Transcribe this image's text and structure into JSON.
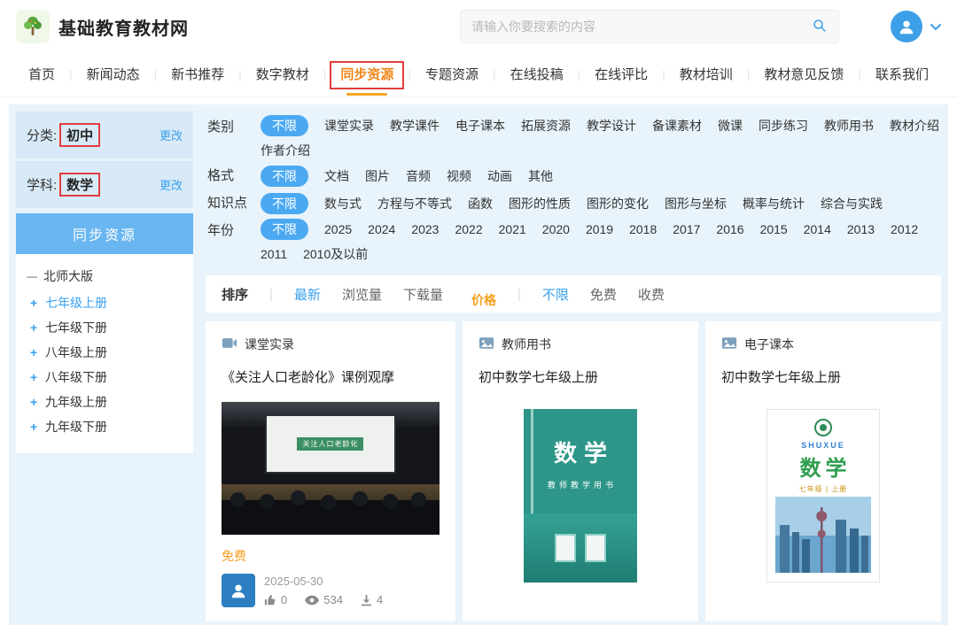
{
  "header": {
    "site_title": "基础教育教材网",
    "search": {
      "placeholder": "请输入你要搜索的内容"
    }
  },
  "nav": {
    "items": [
      {
        "label": "首页"
      },
      {
        "label": "新闻动态"
      },
      {
        "label": "新书推荐"
      },
      {
        "label": "数字教材"
      },
      {
        "label": "同步资源",
        "active": true
      },
      {
        "label": "专题资源"
      },
      {
        "label": "在线投稿"
      },
      {
        "label": "在线评比"
      },
      {
        "label": "教材培训"
      },
      {
        "label": "教材意见反馈"
      },
      {
        "label": "联系我们"
      }
    ]
  },
  "sidebar": {
    "category": {
      "label": "分类:",
      "value": "初中",
      "action": "更改"
    },
    "subject": {
      "label": "学科:",
      "value": "数学",
      "action": "更改"
    },
    "panel_title": "同步资源",
    "edition": "北师大版",
    "grades": [
      {
        "label": "七年级上册",
        "active": true
      },
      {
        "label": "七年级下册"
      },
      {
        "label": "八年级上册"
      },
      {
        "label": "八年级下册"
      },
      {
        "label": "九年级上册"
      },
      {
        "label": "九年级下册"
      }
    ]
  },
  "filters": [
    {
      "label": "类别",
      "selected": "不限",
      "options": [
        "不限",
        "课堂实录",
        "教学课件",
        "电子课本",
        "拓展资源",
        "教学设计",
        "备课素材",
        "微课",
        "同步练习",
        "教师用书",
        "教材介绍",
        "作者介绍"
      ]
    },
    {
      "label": "格式",
      "selected": "不限",
      "options": [
        "不限",
        "文档",
        "图片",
        "音频",
        "视频",
        "动画",
        "其他"
      ]
    },
    {
      "label": "知识点",
      "selected": "不限",
      "options": [
        "不限",
        "数与式",
        "方程与不等式",
        "函数",
        "图形的性质",
        "图形的变化",
        "图形与坐标",
        "概率与统计",
        "综合与实践"
      ]
    },
    {
      "label": "年份",
      "selected": "不限",
      "options": [
        "不限",
        "2025",
        "2024",
        "2023",
        "2022",
        "2021",
        "2020",
        "2019",
        "2018",
        "2017",
        "2016",
        "2015",
        "2014",
        "2013",
        "2012",
        "2011",
        "2010及以前"
      ]
    }
  ],
  "sort_bar": {
    "sort_label": "排序",
    "sort_options": [
      {
        "label": "最新",
        "active": true
      },
      {
        "label": "浏览量"
      },
      {
        "label": "下载量"
      }
    ],
    "price_label": "价格",
    "price_options": [
      {
        "label": "不限",
        "active": true
      },
      {
        "label": "免费"
      },
      {
        "label": "收费"
      }
    ]
  },
  "cards": [
    {
      "type": "课堂实录",
      "title": "《关注人口老龄化》课例观摩",
      "image_caption": "关注人口老龄化",
      "price": "免费",
      "date": "2025-05-30",
      "likes": "0",
      "views": "534",
      "downloads": "4"
    },
    {
      "type": "教师用书",
      "title": "初中数学七年级上册",
      "cover": {
        "title": "数学",
        "subtitle": "教师教学用书"
      }
    },
    {
      "type": "电子课本",
      "title": "初中数学七年级上册",
      "cover": {
        "pinyin": "SHUXUE",
        "title": "数学",
        "edition": "七年级 | 上册"
      }
    }
  ],
  "colors": {
    "accent_blue": "#3aa0ee",
    "pill_blue": "#4ba9f2",
    "orange": "#f5a01e",
    "active_tab_orange": "#f0861a",
    "annotation_red": "#e23c3c",
    "page_bg": "#e8f3fb",
    "sidebar_box_bg": "#d8eaf7",
    "panel_header_blue": "#69b6f1"
  }
}
